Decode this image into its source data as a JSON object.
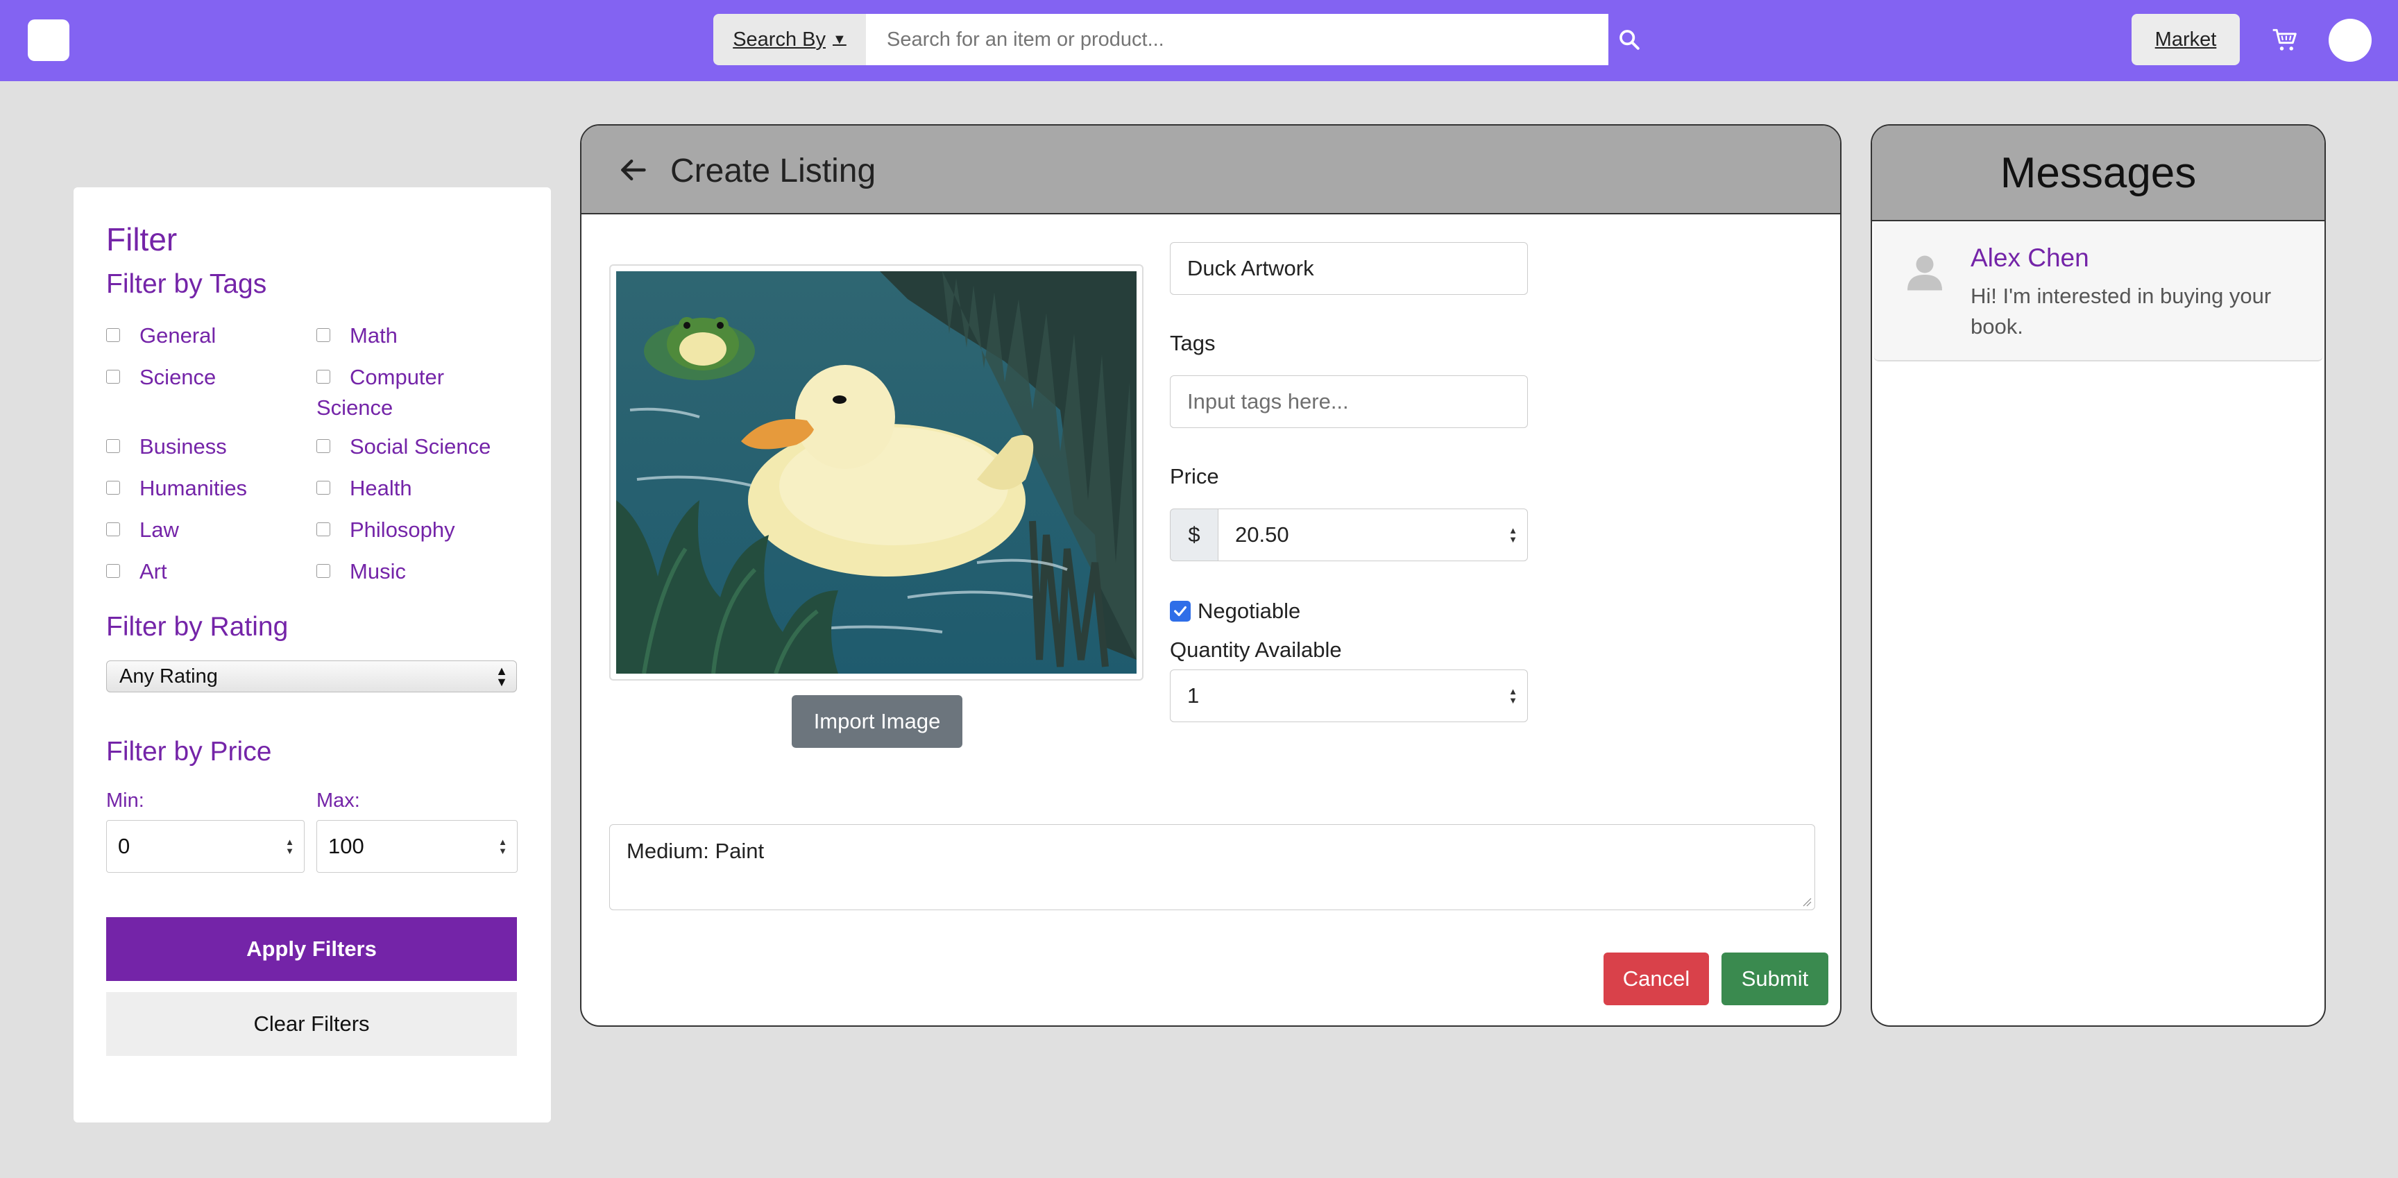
{
  "topbar": {
    "search_by_label": "Search By",
    "search_placeholder": "Search for an item or product...",
    "market_label": "Market",
    "accent_color": "#8363f2"
  },
  "filter": {
    "title": "Filter",
    "tags_heading": "Filter by Tags",
    "tags": [
      "General",
      "Math",
      "Science",
      "Computer Science",
      "Business",
      "Social Science",
      "Humanities",
      "Health",
      "Law",
      "Philosophy",
      "Art",
      "Music"
    ],
    "rating_heading": "Filter by Rating",
    "rating_selected": "Any Rating",
    "price_heading": "Filter by Price",
    "min_label": "Min:",
    "max_label": "Max:",
    "min_value": "0",
    "max_value": "100",
    "apply_label": "Apply Filters",
    "clear_label": "Clear Filters"
  },
  "listing": {
    "title": "Create Listing",
    "name_value": "Duck Artwork",
    "tags_label": "Tags",
    "tags_placeholder": "Input tags here...",
    "price_label": "Price",
    "currency_symbol": "$",
    "price_value": "20.50",
    "negotiable_label": "Negotiable",
    "negotiable_checked": true,
    "quantity_label": "Quantity Available",
    "quantity_value": "1",
    "import_label": "Import Image",
    "description": "Medium: Paint",
    "cancel_label": "Cancel",
    "submit_label": "Submit"
  },
  "messages": {
    "title": "Messages",
    "items": [
      {
        "name": "Alex Chen",
        "text": "Hi! I'm interested in buying your book."
      }
    ]
  }
}
